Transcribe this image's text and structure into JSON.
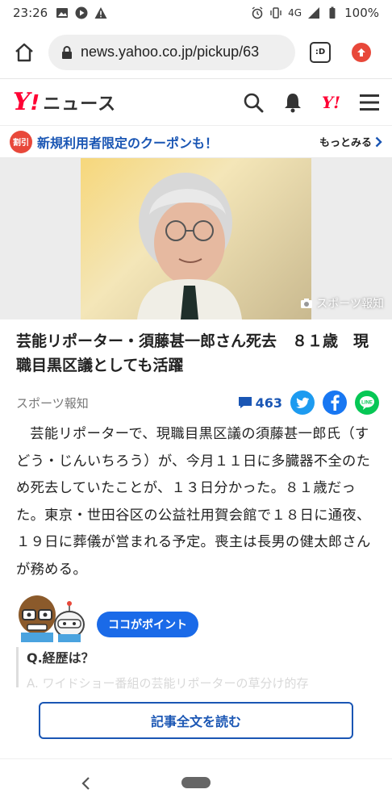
{
  "statusbar": {
    "time": "23:26",
    "network": "4G",
    "battery": "100%"
  },
  "browser": {
    "url": "news.yahoo.co.jp/pickup/63",
    "tab_label": ":D"
  },
  "header": {
    "logo_y": "Y",
    "logo_ex": "!",
    "logo_text": "ニュース",
    "yicon_text": "Y!"
  },
  "coupon": {
    "badge": "割引",
    "text": "新規利用者限定のクーポンも！",
    "more": "もっとみる"
  },
  "hero": {
    "credit": "スポーツ報知"
  },
  "article": {
    "title": "芸能リポーター・須藤甚一郎さん死去　８１歳　現職目黒区議としても活躍",
    "source": "スポーツ報知",
    "comment_count": "463",
    "body": "芸能リポーターで、現職目黒区議の須藤甚一郎氏（すどう・じんいちろう）が、今月１１日に多臓器不全のため死去していたことが、１３日分かった。８１歳だった。東京・世田谷区の公益社用賀会館で１８日に通夜、１９日に葬儀が営まれる予定。喪主は長男の健太郎さんが務める。"
  },
  "points": {
    "pill": "ココがポイント",
    "question": "Q.経歴は？",
    "answer_preview": "A. ワイドショー番組の芸能リポーターの草分け的存"
  },
  "read_button": "記事全文を読む",
  "colors": {
    "accent": "#1a56b4",
    "brand": "#ff0033"
  }
}
